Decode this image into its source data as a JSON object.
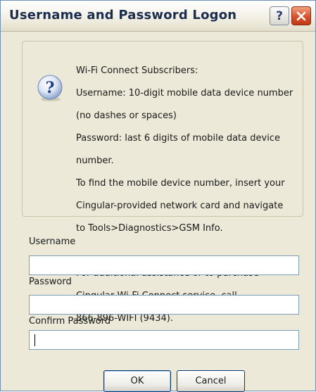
{
  "window": {
    "title": "Username and Password Logon",
    "help_button_glyph": "?",
    "close_icon": "close-icon",
    "colors": {
      "title_text": "#1b2c4f",
      "close_button": "#d8512c",
      "dialog_bg": "#ece9d8",
      "field_border": "#7f9db9"
    }
  },
  "info": {
    "icon": "question-mark-icon",
    "lines": [
      "Wi-Fi Connect Subscribers:",
      "Username: 10-digit mobile data device number",
      "(no dashes or spaces)",
      "Password: last 6 digits of mobile data device",
      "number.",
      "To find the mobile device number, insert your",
      "Cingular-provided network card and navigate",
      "to Tools>Diagnostics>GSM Info.",
      "",
      "For additional assistance or to purchase",
      "Cingular Wi-Fi Connect service, call",
      "866-896-WIFI (9434)."
    ]
  },
  "form": {
    "username_label": "Username",
    "username_value": "",
    "password_label": "Password",
    "password_value": "",
    "confirm_label": "Confirm Password",
    "confirm_value": ""
  },
  "buttons": {
    "ok": "OK",
    "cancel": "Cancel"
  }
}
